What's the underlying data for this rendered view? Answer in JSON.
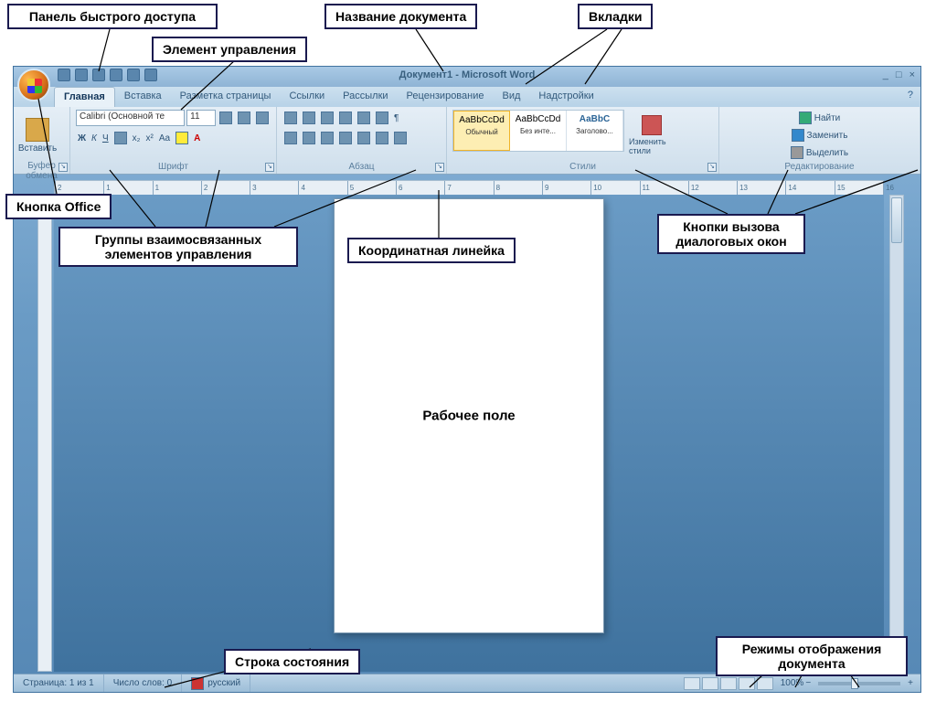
{
  "callouts": {
    "quick_access": "Панель быстрого доступа",
    "document_name": "Название документа",
    "tabs": "Вкладки",
    "control_element": "Элемент управления",
    "office_button": "Кнопка Office",
    "groups": "Группы взаимосвязанных элементов управления",
    "ruler": "Координатная линейка",
    "dialog_launchers": "Кнопки вызова диалоговых окон",
    "workspace": "Рабочее поле",
    "status_bar": "Строка состояния",
    "view_modes": "Режимы отображения документа"
  },
  "titlebar": {
    "document_title": "Документ1 - Microsoft Word"
  },
  "tabs_row": {
    "items": [
      "Главная",
      "Вставка",
      "Разметка страницы",
      "Ссылки",
      "Рассылки",
      "Рецензирование",
      "Вид",
      "Надстройки"
    ]
  },
  "ribbon": {
    "clipboard": {
      "label": "Буфер обмена",
      "paste": "Вставить"
    },
    "font": {
      "label": "Шрифт",
      "name": "Calibri (Основной те",
      "size": "11"
    },
    "paragraph": {
      "label": "Абзац"
    },
    "styles": {
      "label": "Стили",
      "items": [
        {
          "sample": "АаBbCcDd",
          "name": "Обычный"
        },
        {
          "sample": "АаBbCcDd",
          "name": "Без инте..."
        },
        {
          "sample": "АаBbC",
          "name": "Заголово..."
        }
      ],
      "change": "Изменить стили"
    },
    "editing": {
      "label": "Редактирование",
      "find": "Найти",
      "replace": "Заменить",
      "select": "Выделить"
    }
  },
  "ruler_marks": [
    "2",
    "1",
    "1",
    "2",
    "3",
    "4",
    "5",
    "6",
    "7",
    "8",
    "9",
    "10",
    "11",
    "12",
    "13",
    "14",
    "15",
    "16"
  ],
  "status": {
    "page": "Страница: 1 из 1",
    "words": "Число слов: 0",
    "lang": "русский",
    "zoom": "100%"
  }
}
